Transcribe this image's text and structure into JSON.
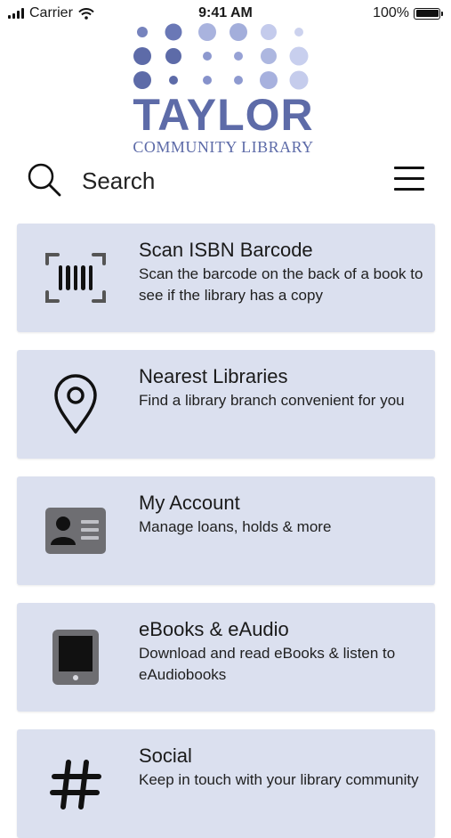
{
  "status_bar": {
    "carrier": "Carrier",
    "time": "9:41 AM",
    "battery": "100%"
  },
  "logo": {
    "name": "TAYLOR",
    "subtitle": "COMMUNITY LIBRARY"
  },
  "search": {
    "label": "Search"
  },
  "cards": [
    {
      "title": "Scan ISBN Barcode",
      "description": "Scan the barcode on the back of a book to see if the library has a copy",
      "icon": "barcode-scan-icon"
    },
    {
      "title": "Nearest Libraries",
      "description": "Find a library branch convenient for you",
      "icon": "map-pin-icon"
    },
    {
      "title": "My Account",
      "description": "Manage loans, holds & more",
      "icon": "id-card-icon"
    },
    {
      "title": "eBooks & eAudio",
      "description": "Download and read eBooks & listen to eAudiobooks",
      "icon": "tablet-icon"
    },
    {
      "title": "Social",
      "description": "Keep in touch with your library community",
      "icon": "hashtag-icon"
    }
  ],
  "colors": {
    "brand": "#5d6ba8",
    "card_bg": "#dbe0ef",
    "icon_gray": "#6e6e72"
  }
}
